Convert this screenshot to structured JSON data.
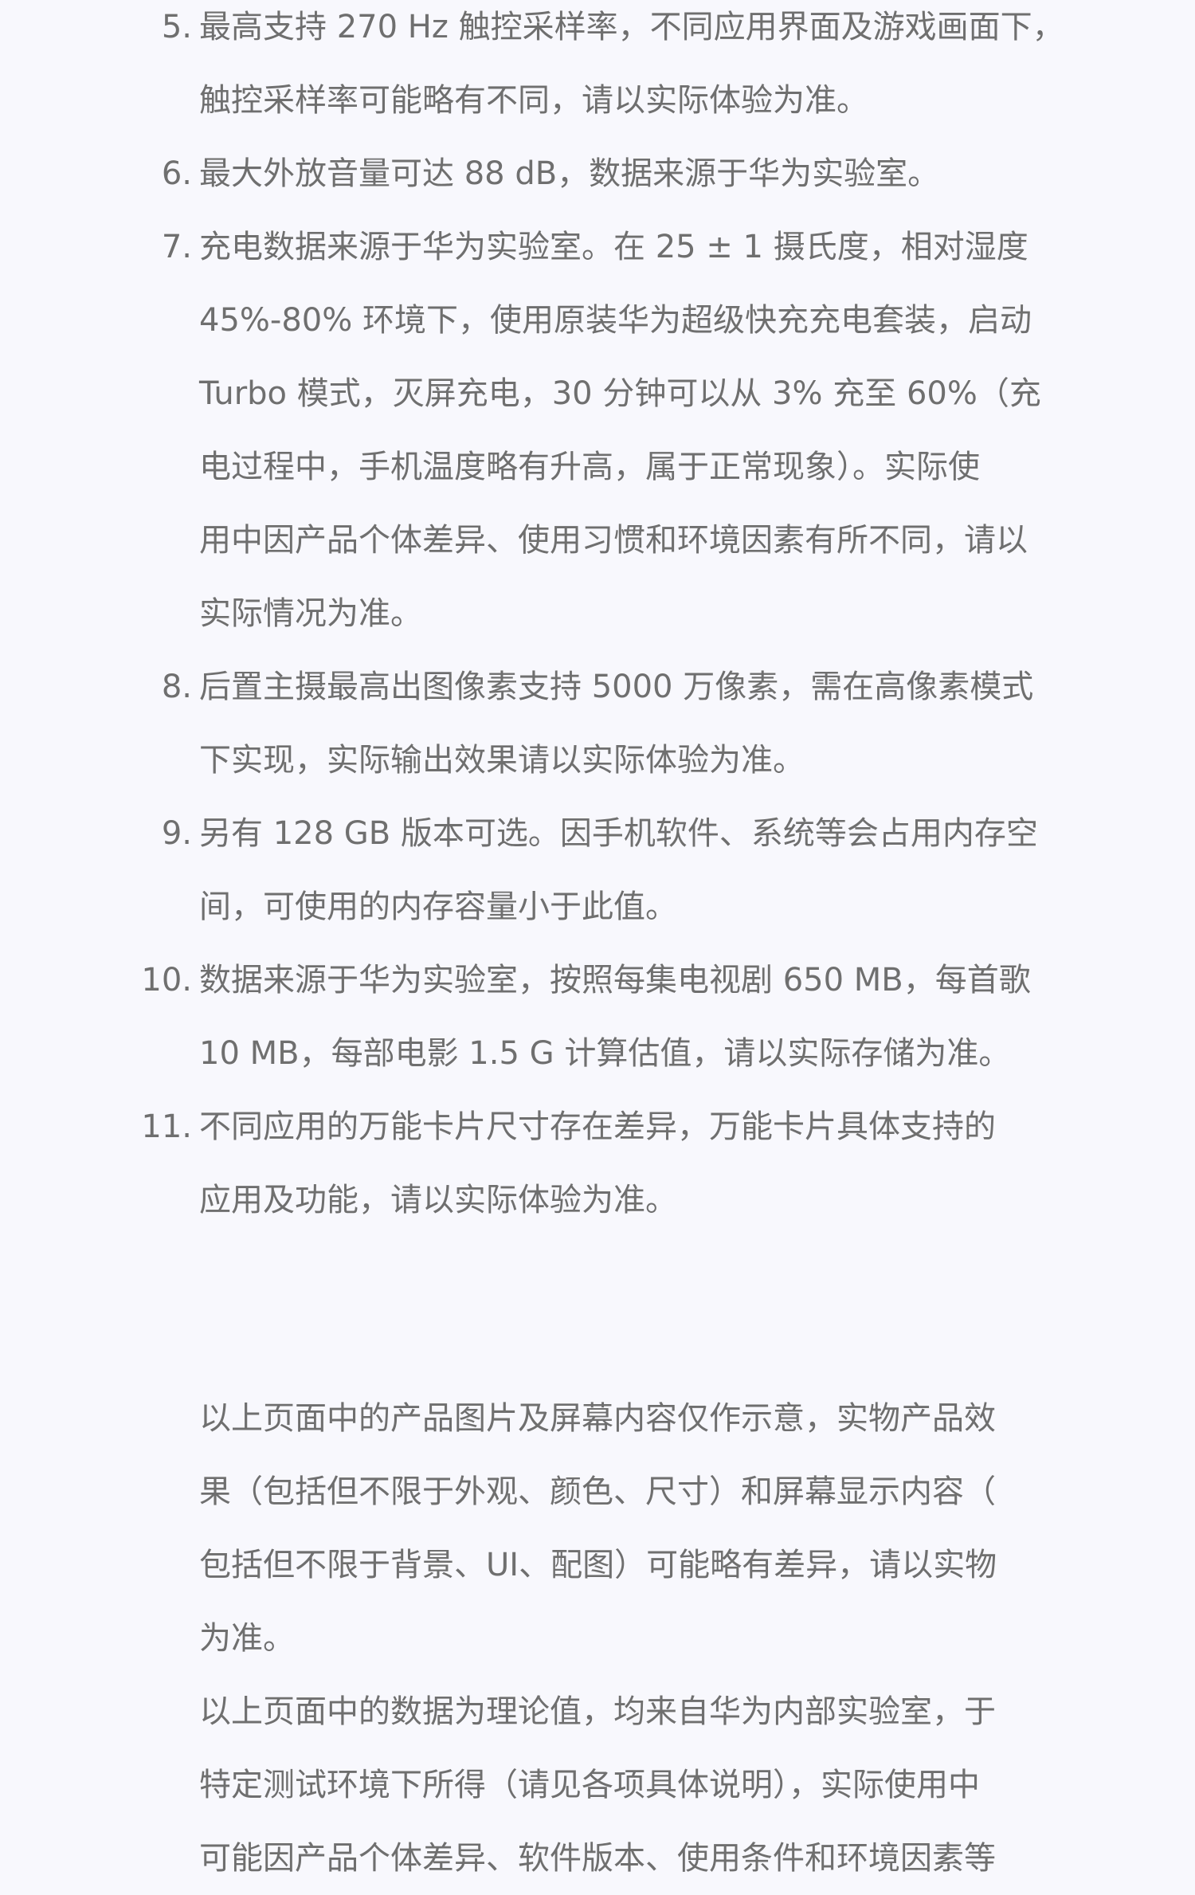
{
  "notes": [
    {
      "num": "5.",
      "text": "最高支持 270 Hz 触控采样率，不同应用界面及游戏画面下，\n触控采样率可能略有不同，请以实际体验为准。"
    },
    {
      "num": "6.",
      "text": "最大外放音量可达 88 dB，数据来源于华为实验室。"
    },
    {
      "num": "7.",
      "text": "充电数据来源于华为实验室。在 25 ± 1 摄氏度，相对湿度\n45%-80% 环境下，使用原装华为超级快充充电套装，启动\nTurbo 模式，灭屏充电，30 分钟可以从 3% 充至 60%（充\n电过程中，手机温度略有升高，属于正常现象）。实际使\n用中因产品个体差异、使用习惯和环境因素有所不同，请以\n实际情况为准。"
    },
    {
      "num": "8.",
      "text": "后置主摄最高出图像素支持 5000 万像素，需在高像素模式\n下实现，实际输出效果请以实际体验为准。"
    },
    {
      "num": "9.",
      "text": "另有 128 GB 版本可选。因手机软件、系统等会占用内存空\n间，可使用的内存容量小于此值。"
    },
    {
      "num": "10.",
      "text": "数据来源于华为实验室，按照每集电视剧 650 MB，每首歌\n10 MB，每部电影 1.5 G 计算估值，请以实际存储为准。"
    },
    {
      "num": "11.",
      "text": "不同应用的万能卡片尺寸存在差异，万能卡片具体支持的\n应用及功能，请以实际体验为准。"
    }
  ],
  "disclaimer": [
    "以上页面中的产品图片及屏幕内容仅作示意，实物产品效\n果（包括但不限于外观、颜色、尺寸）和屏幕显示内容（\n包括但不限于背景、UI、配图）可能略有差异，请以实物\n为准。",
    "以上页面中的数据为理论值，均来自华为内部实验室，于\n特定测试环境下所得（请见各项具体说明），实际使用中\n可能因产品个体差异、软件版本、使用条件和环境因素等"
  ]
}
